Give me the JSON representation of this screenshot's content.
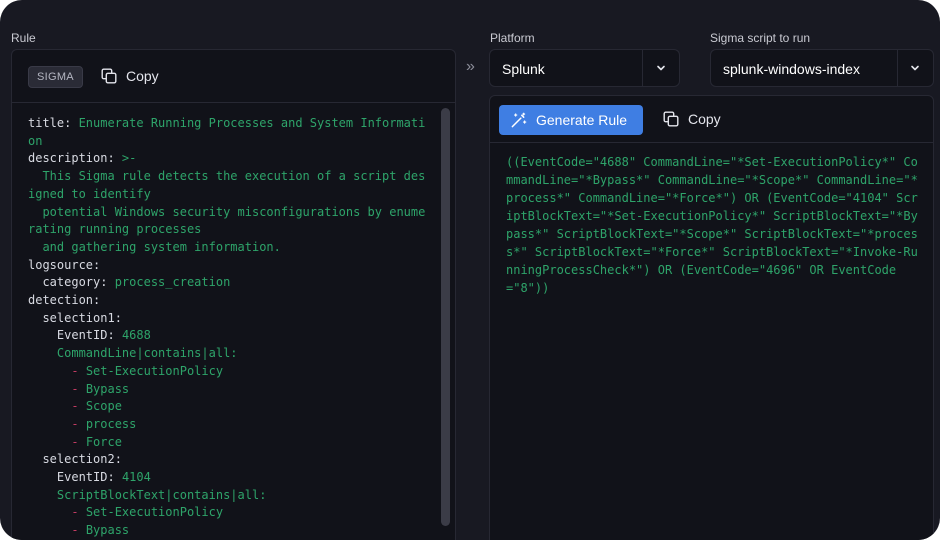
{
  "rule": {
    "label": "Rule",
    "badge": "SIGMA",
    "copy_label": "Copy",
    "code_lines": [
      [
        {
          "t": "title: ",
          "c": "k"
        },
        {
          "t": "Enumerate Running Processes and System Information",
          "c": "v"
        }
      ],
      [
        {
          "t": "description: ",
          "c": "k"
        },
        {
          "t": ">-",
          "c": "v"
        }
      ],
      [
        {
          "t": "  This Sigma rule detects the execution of a script designed to identify",
          "c": "v"
        }
      ],
      [
        {
          "t": "  potential Windows security misconfigurations by enumerating running processes",
          "c": "v"
        }
      ],
      [
        {
          "t": "  and gathering system information.",
          "c": "v"
        }
      ],
      [
        {
          "t": "logsource:",
          "c": "k"
        }
      ],
      [
        {
          "t": "  category: ",
          "c": "k"
        },
        {
          "t": "process_creation",
          "c": "v"
        }
      ],
      [
        {
          "t": "detection:",
          "c": "k"
        }
      ],
      [
        {
          "t": "  selection1:",
          "c": "k"
        }
      ],
      [
        {
          "t": "    EventID: ",
          "c": "k"
        },
        {
          "t": "4688",
          "c": "v"
        }
      ],
      [
        {
          "t": "    CommandLine|contains|all:",
          "c": "v"
        }
      ],
      [
        {
          "t": "      - ",
          "c": "d"
        },
        {
          "t": "Set-ExecutionPolicy",
          "c": "v"
        }
      ],
      [
        {
          "t": "      - ",
          "c": "d"
        },
        {
          "t": "Bypass",
          "c": "v"
        }
      ],
      [
        {
          "t": "      - ",
          "c": "d"
        },
        {
          "t": "Scope",
          "c": "v"
        }
      ],
      [
        {
          "t": "      - ",
          "c": "d"
        },
        {
          "t": "process",
          "c": "v"
        }
      ],
      [
        {
          "t": "      - ",
          "c": "d"
        },
        {
          "t": "Force",
          "c": "v"
        }
      ],
      [
        {
          "t": "  selection2:",
          "c": "k"
        }
      ],
      [
        {
          "t": "    EventID: ",
          "c": "k"
        },
        {
          "t": "4104",
          "c": "v"
        }
      ],
      [
        {
          "t": "    ScriptBlockText|contains|all:",
          "c": "v"
        }
      ],
      [
        {
          "t": "      - ",
          "c": "d"
        },
        {
          "t": "Set-ExecutionPolicy",
          "c": "v"
        }
      ],
      [
        {
          "t": "      - ",
          "c": "d"
        },
        {
          "t": "Bypass",
          "c": "v"
        }
      ]
    ]
  },
  "platform": {
    "label": "Platform",
    "selected": "Splunk"
  },
  "script": {
    "label": "Sigma script to run",
    "selected": "splunk-windows-index"
  },
  "output": {
    "generate_label": "Generate Rule",
    "copy_label": "Copy",
    "query": "((EventCode=\"4688\" CommandLine=\"*Set-ExecutionPolicy*\" CommandLine=\"*Bypass*\" CommandLine=\"*Scope*\" CommandLine=\"*process*\" CommandLine=\"*Force*\") OR (EventCode=\"4104\" ScriptBlockText=\"*Set-ExecutionPolicy*\" ScriptBlockText=\"*Bypass*\" ScriptBlockText=\"*Scope*\" ScriptBlockText=\"*process*\" ScriptBlockText=\"*Force*\" ScriptBlockText=\"*Invoke-RunningProcessCheck*\") OR (EventCode=\"4696\" OR EventCode=\"8\"))"
  },
  "icons": {
    "arrow": "double-chevron-right-icon",
    "copy": "copy-icon",
    "wand": "magic-wand-icon",
    "chevron": "chevron-down-icon"
  },
  "colors": {
    "background": "#181922",
    "panel": "#111219",
    "accent": "#3f7ee3",
    "code_value": "#2ea46a",
    "code_dash": "#c23b62"
  }
}
